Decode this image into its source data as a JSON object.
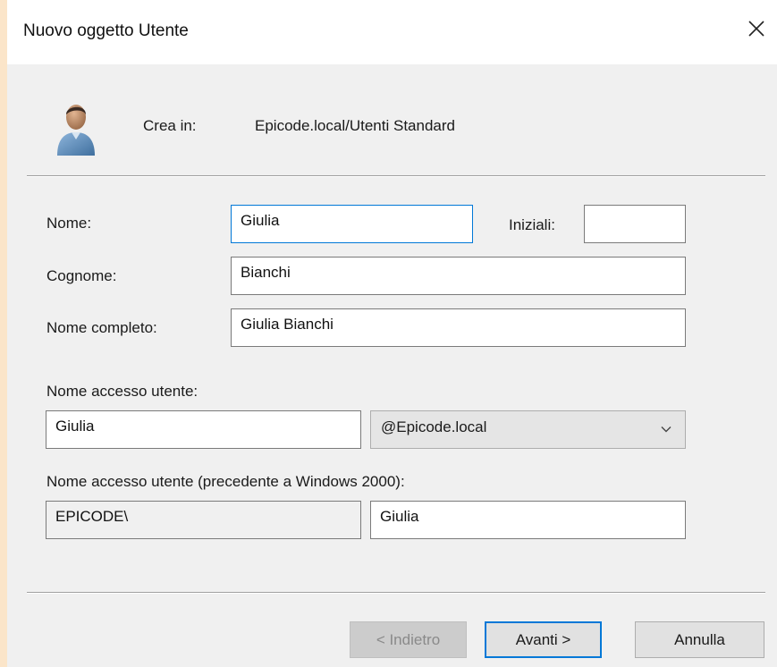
{
  "window": {
    "title": "Nuovo oggetto Utente",
    "close_icon": "close-icon"
  },
  "header": {
    "avatar_icon": "user-icon",
    "create_in_label": "Crea in:",
    "create_in_value": "Epicode.local/Utenti Standard"
  },
  "form": {
    "first_name_label": "Nome:",
    "first_name_value": "Giulia",
    "initials_label": "Iniziali:",
    "initials_value": "",
    "last_name_label": "Cognome:",
    "last_name_value": "Bianchi",
    "full_name_label": "Nome completo:",
    "full_name_value": "Giulia Bianchi",
    "logon_label": "Nome accesso utente:",
    "logon_value": "Giulia",
    "domain_selected": "@Epicode.local",
    "pre2000_label": "Nome accesso utente (precedente a Windows 2000):",
    "pre2000_domain": "EPICODE\\",
    "pre2000_value": "Giulia"
  },
  "buttons": {
    "back": "< Indietro",
    "next": "Avanti >",
    "cancel": "Annulla"
  },
  "colors": {
    "focus_border": "#0078d7",
    "dialog_bg": "#f0f0f0",
    "backdrop": "#fbe5c9"
  }
}
